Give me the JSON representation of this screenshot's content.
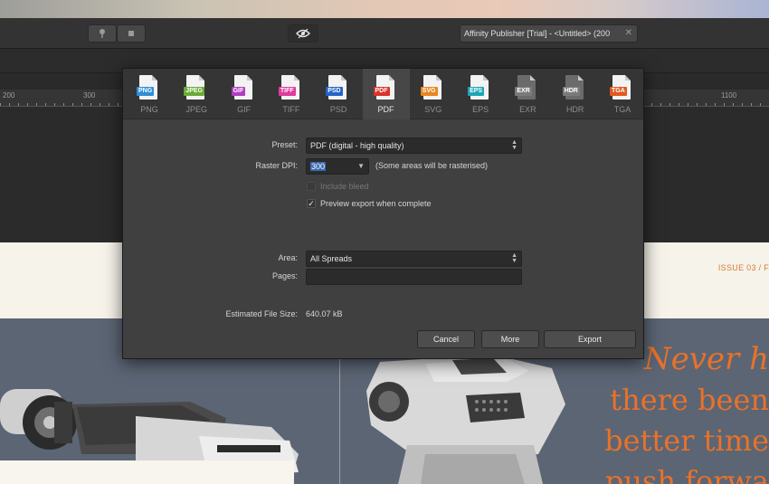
{
  "window": {
    "title": "Affinity Publisher [Trial] - <Untitled> (200",
    "title_close": "✕",
    "pin_icon": "pin-icon",
    "view_icon": "view-mode-icon"
  },
  "ruler": {
    "labels": [
      "200",
      "300",
      "1100"
    ]
  },
  "page": {
    "issue_text": "ISSUE 03 / F",
    "headline": [
      "Never h",
      "there been",
      "better time",
      "push forwa"
    ]
  },
  "export_dialog": {
    "formats": [
      {
        "badge": "PNG",
        "name": "PNG",
        "color": "#2f8fd8"
      },
      {
        "badge": "JPEG",
        "name": "JPEG",
        "color": "#6aab34"
      },
      {
        "badge": "GIF",
        "name": "GIF",
        "color": "#b23cc4"
      },
      {
        "badge": "TIFF",
        "name": "TIFF",
        "color": "#e03b9e"
      },
      {
        "badge": "PSD",
        "name": "PSD",
        "color": "#2563c9"
      },
      {
        "badge": "PDF",
        "name": "PDF",
        "color": "#d9342b"
      },
      {
        "badge": "SVG",
        "name": "SVG",
        "color": "#e8861f"
      },
      {
        "badge": "EPS",
        "name": "EPS",
        "color": "#1ea5b8"
      },
      {
        "badge": "EXR",
        "name": "EXR",
        "color": "#7a7a7a"
      },
      {
        "badge": "HDR",
        "name": "HDR",
        "color": "#7a7a7a"
      },
      {
        "badge": "TGA",
        "name": "TGA",
        "color": "#e05a1f"
      }
    ],
    "selected_format": "PDF",
    "preset_label": "Preset:",
    "preset_value": "PDF (digital - high quality)",
    "raster_dpi_label": "Raster DPI:",
    "raster_dpi_value": "300",
    "raster_note": "(Some areas will be rasterised)",
    "include_bleed_label": "Include bleed",
    "include_bleed_checked": false,
    "preview_label": "Preview export when complete",
    "preview_checked": "✓",
    "area_label": "Area:",
    "area_value": "All Spreads",
    "pages_label": "Pages:",
    "pages_value": "",
    "size_label": "Estimated File Size:",
    "size_value": "640.07 kB",
    "buttons": {
      "cancel": "Cancel",
      "more": "More",
      "export": "Export"
    }
  }
}
